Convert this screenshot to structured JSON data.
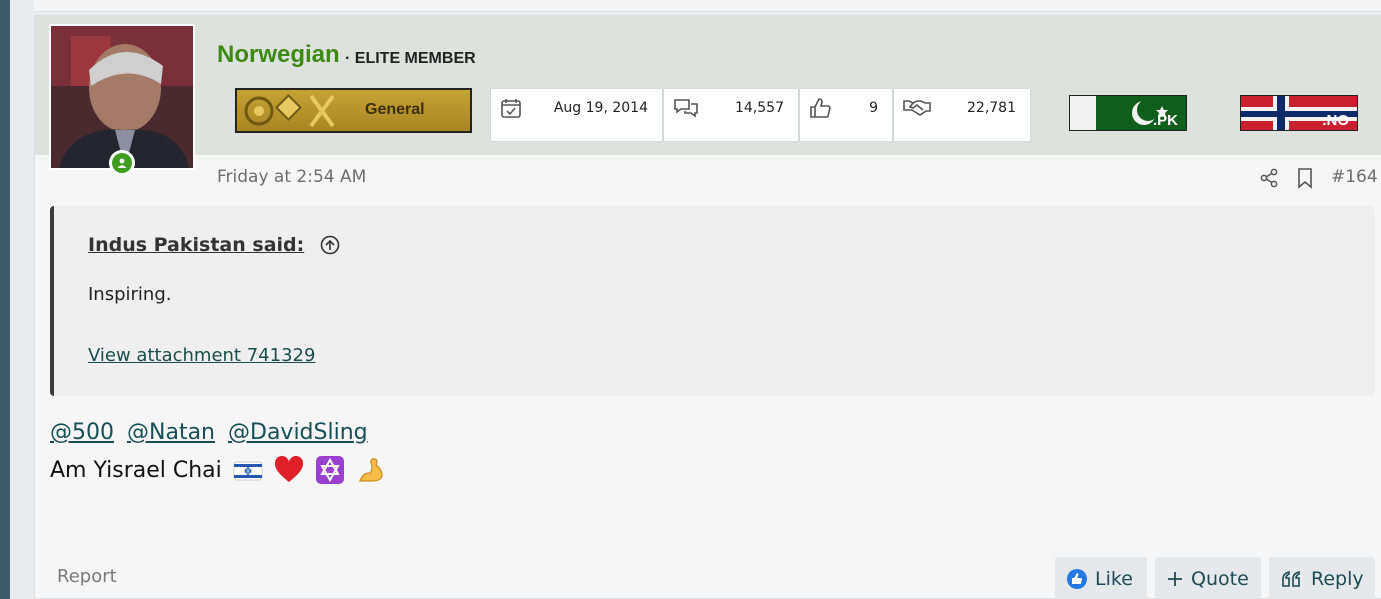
{
  "post": {
    "username": "Norwegian",
    "user_title": "· ELITE MEMBER",
    "rank_label": "General",
    "stats": [
      {
        "icon": "calendar-check-icon",
        "value": "Aug 19, 2014"
      },
      {
        "icon": "messages-icon",
        "value": "14,557"
      },
      {
        "icon": "thumbs-up-icon",
        "value": "9"
      },
      {
        "icon": "handshake-icon",
        "value": "22,781"
      }
    ],
    "flags": [
      {
        "icon": "pakistan-flag-icon",
        "label": ".PK"
      },
      {
        "icon": "norway-flag-icon",
        "label": ".NO"
      }
    ],
    "time": "Friday at 2:54 AM",
    "number": "#164",
    "quote": {
      "author": "Indus Pakistan said:",
      "text": "Inspiring.",
      "link": "View attachment 741329"
    },
    "mentions": [
      "@500",
      "@Natan",
      "@DavidSling"
    ],
    "message": "Am Yisrael Chai",
    "emojis": [
      "israel-flag-emoji",
      "red-heart-emoji",
      "star-of-david-emoji",
      "flexed-biceps-emoji"
    ],
    "report_label": "Report",
    "actions": {
      "like": "Like",
      "quote": "Quote",
      "reply": "Reply"
    }
  },
  "colors": {
    "username": "#3d8a13",
    "link": "#164f57",
    "header_bg": "#dde2df"
  }
}
